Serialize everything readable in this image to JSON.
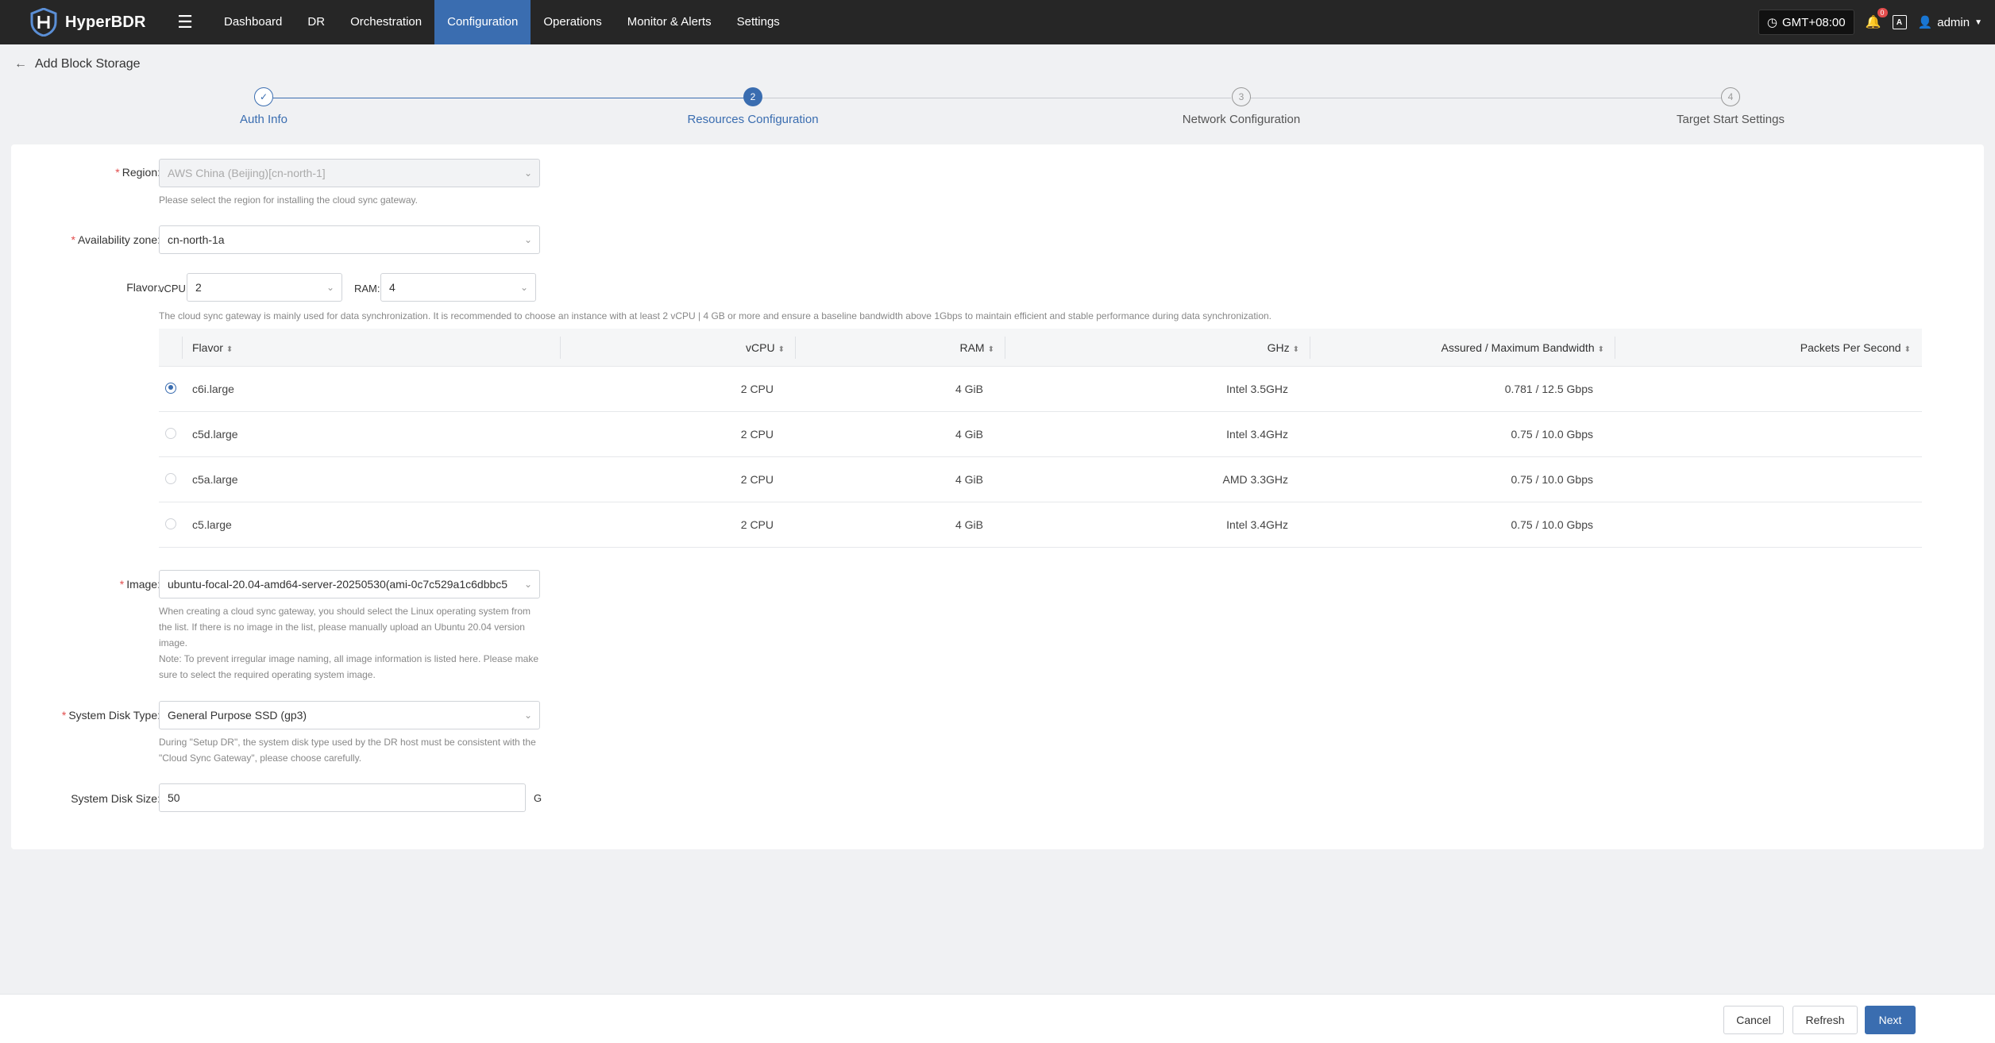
{
  "app": {
    "name": "HyperBDR",
    "nav": [
      "Dashboard",
      "DR",
      "Orchestration",
      "Configuration",
      "Operations",
      "Monitor & Alerts",
      "Settings"
    ],
    "active_nav": "Configuration",
    "timezone": "GMT+08:00",
    "notification_count": "0",
    "lang_icon": "A",
    "user": "admin"
  },
  "page": {
    "title": "Add Block Storage"
  },
  "steps": [
    {
      "num": "✓",
      "label": "Auth Info",
      "state": "done"
    },
    {
      "num": "2",
      "label": "Resources Configuration",
      "state": "current"
    },
    {
      "num": "3",
      "label": "Network Configuration",
      "state": "todo"
    },
    {
      "num": "4",
      "label": "Target Start Settings",
      "state": "todo"
    }
  ],
  "form": {
    "region": {
      "label": "Region:",
      "value": "AWS China (Beijing)[cn-north-1]",
      "hint": "Please select the region for installing the cloud sync gateway."
    },
    "az": {
      "label": "Availability zone:",
      "value": "cn-north-1a"
    },
    "flavor": {
      "label": "Flavor:",
      "vcpu_label": "vCPU:",
      "vcpu_value": "2",
      "ram_label": "RAM:",
      "ram_value": "4",
      "hint": "The cloud sync gateway is mainly used for data synchronization. It is recommended to choose an instance with at least 2 vCPU | 4 GB or more and ensure a baseline bandwidth above 1Gbps to maintain efficient and stable performance during data synchronization."
    },
    "table": {
      "headers": [
        "Flavor",
        "vCPU",
        "RAM",
        "GHz",
        "Assured / Maximum Bandwidth",
        "Packets Per Second"
      ],
      "rows": [
        {
          "flavor": "c6i.large",
          "vcpu": "2 CPU",
          "ram": "4 GiB",
          "ghz": "Intel 3.5GHz",
          "bandwidth": "0.781 / 12.5 Gbps",
          "pps": "",
          "selected": true
        },
        {
          "flavor": "c5d.large",
          "vcpu": "2 CPU",
          "ram": "4 GiB",
          "ghz": "Intel 3.4GHz",
          "bandwidth": "0.75 / 10.0 Gbps",
          "pps": "",
          "selected": false
        },
        {
          "flavor": "c5a.large",
          "vcpu": "2 CPU",
          "ram": "4 GiB",
          "ghz": "AMD 3.3GHz",
          "bandwidth": "0.75 / 10.0 Gbps",
          "pps": "",
          "selected": false
        },
        {
          "flavor": "c5.large",
          "vcpu": "2 CPU",
          "ram": "4 GiB",
          "ghz": "Intel 3.4GHz",
          "bandwidth": "0.75 / 10.0 Gbps",
          "pps": "",
          "selected": false
        }
      ]
    },
    "image": {
      "label": "Image:",
      "value": "ubuntu-focal-20.04-amd64-server-20250530(ami-0c7c529a1c6dbbc5",
      "hint_1": "When creating a cloud sync gateway, you should select the Linux operating system from",
      "hint_2": "the list. If there is no image in the list, please manually upload an Ubuntu 20.04 version",
      "hint_3": "image.",
      "hint_4": "Note: To prevent irregular image naming, all image information is listed here. Please make",
      "hint_5": "sure to select the required operating system image."
    },
    "disk_type": {
      "label": "System Disk Type:",
      "value": "General Purpose SSD (gp3)",
      "hint_1": "During \"Setup DR\", the system disk type used by the DR host must be consistent with the",
      "hint_2": "\"Cloud Sync Gateway\", please choose carefully."
    },
    "disk_size": {
      "label": "System Disk Size:",
      "value": "50",
      "unit": "G"
    }
  },
  "footer": {
    "cancel": "Cancel",
    "refresh": "Refresh",
    "next": "Next"
  },
  "colors": {
    "primary": "#3a6db0",
    "topbar": "#262626",
    "required": "#e24c4c"
  }
}
